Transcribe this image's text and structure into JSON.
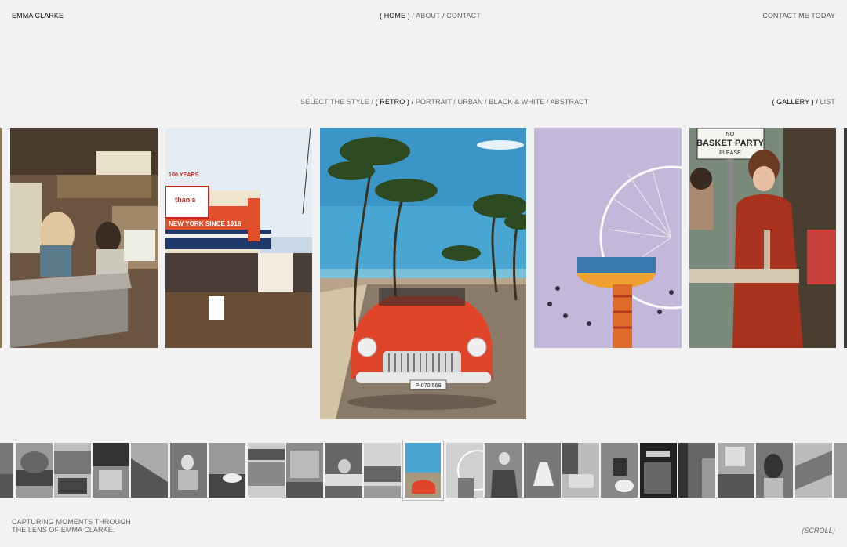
{
  "brand": {
    "name": "EMMA CLARKE"
  },
  "nav": {
    "items": [
      "( HOME )",
      "/ ABOUT",
      "/ CONTACT"
    ]
  },
  "cta": {
    "label": "CONTACT ME TODAY"
  },
  "filters": {
    "prefix": "SELECT THE STYLE /",
    "items": [
      "( RETRO ) /",
      "PORTRAIT /",
      "URBAN /",
      "BLACK & WHITE /",
      "ABSTRACT"
    ]
  },
  "view_toggle": {
    "gallery": "( GALLERY ) /",
    "list": "LIST"
  },
  "footer": {
    "tagline_line1": "CAPTURING MOMENTS THROUGH",
    "tagline_line2": "THE LENS OF EMMA CLARKE.",
    "scroll_label": "(SCROLL)"
  },
  "photos": {
    "rv": {
      "icon": "rv-interior-photo"
    },
    "boardwalk": {
      "icon": "boardwalk-photo",
      "sign_text": "NEW YORK SINCE 1916",
      "badge": "100 YEARS",
      "shop": "than's"
    },
    "car": {
      "icon": "red-convertible-photo",
      "plate": "P-070 568"
    },
    "ferris": {
      "icon": "carnival-ride-photo"
    },
    "party": {
      "icon": "basket-party-photo",
      "sign_line1": "NO",
      "sign_line2": "BASKET PARTY",
      "sign_line3": "PLEASE"
    }
  },
  "thumbnails": {
    "count": 22,
    "selected_index": 10
  },
  "colors": {
    "background": "#f2f2f2",
    "accent_red": "#d8432a"
  }
}
